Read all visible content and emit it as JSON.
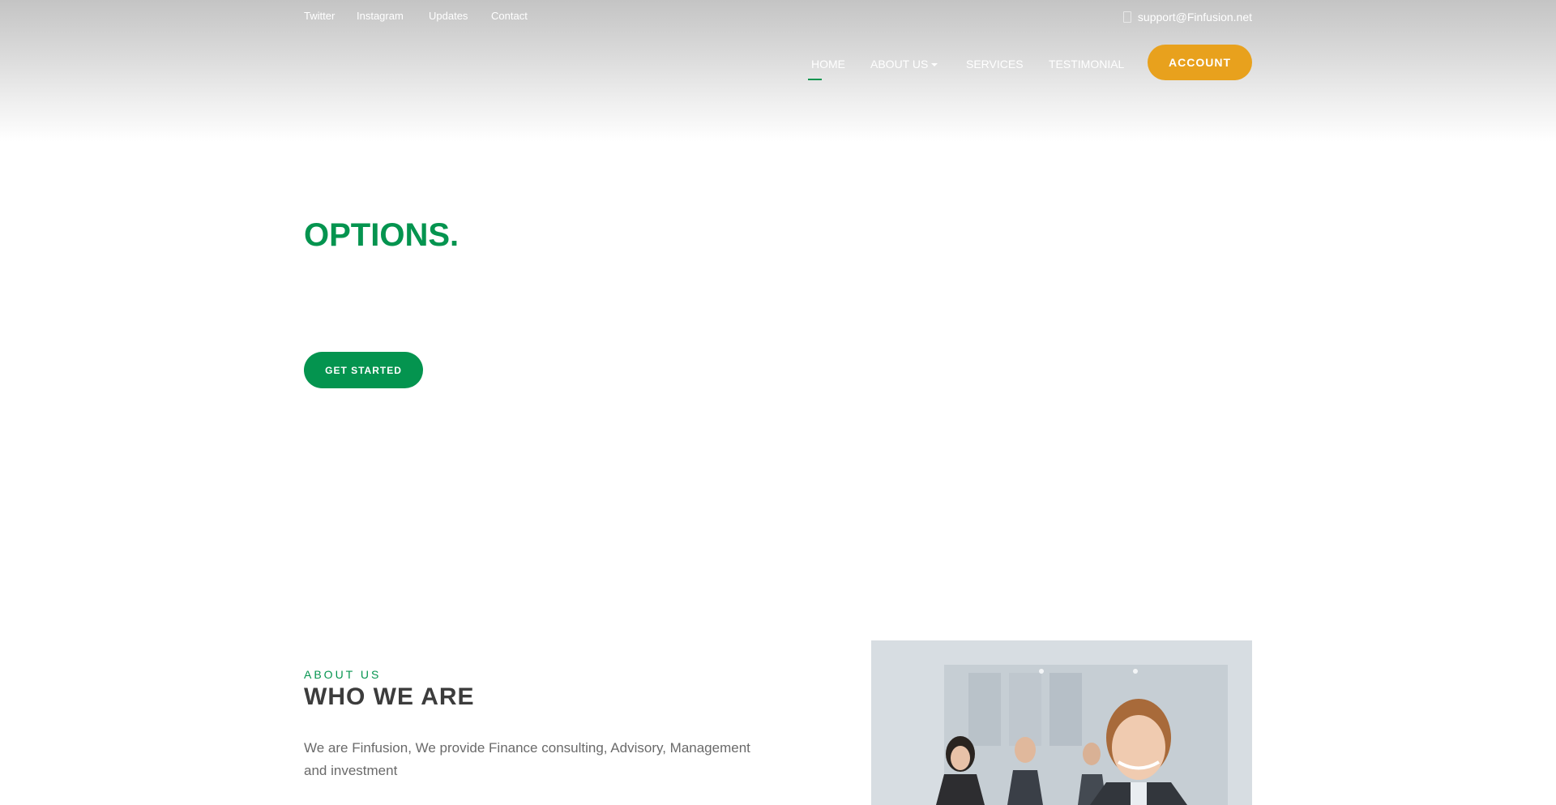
{
  "topbar": {
    "links": [
      "Twitter",
      "Instagram",
      "Updates",
      "Contact"
    ],
    "email": "support@Finfusion.net",
    "email_icon": "envelope-icon"
  },
  "nav": {
    "items": [
      "HOME",
      "ABOUT US",
      "SERVICES",
      "TESTIMONIAL"
    ],
    "active": "HOME",
    "dropdown_item": "ABOUT US",
    "account_label": "ACCOUNT"
  },
  "hero": {
    "title": "OPTIONS.",
    "cta_label": "GET STARTED"
  },
  "about": {
    "kicker": "ABOUT US",
    "title": "WHO WE ARE",
    "body": "We are Finfusion, We provide Finance consulting, Advisory, Management and investment"
  },
  "colors": {
    "brand_green": "#04944f",
    "accent_orange": "#e8a11d",
    "heading_dark": "#3c3c3c",
    "body_gray": "#6a6a6a"
  }
}
